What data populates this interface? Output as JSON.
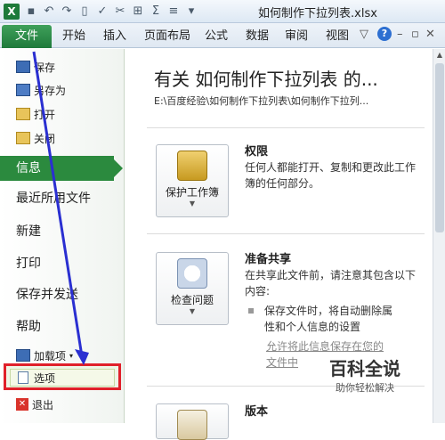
{
  "titlebar": {
    "app_icon": "X",
    "title": "如何制作下拉列表.xlsx"
  },
  "tabs": {
    "file": "文件",
    "items": [
      "开始",
      "插入",
      "页面布局",
      "公式",
      "数据",
      "审阅",
      "视图"
    ],
    "help": "?"
  },
  "nav": {
    "save": "保存",
    "saveas": "另存为",
    "open": "打开",
    "close": "关闭",
    "info": "信息",
    "recent": "最近所用文件",
    "new": "新建",
    "print": "打印",
    "share": "保存并发送",
    "help": "帮助",
    "addins": "加载项",
    "options": "选项",
    "exit": "退出"
  },
  "main": {
    "title": "有关 如何制作下拉列表 的...",
    "path": "E:\\百度经验\\如何制作下拉列表\\如何制作下拉列...",
    "permissions": {
      "button": "保护工作簿",
      "heading": "权限",
      "text": "任何人都能打开、复制和更改此工作簿的任何部分。"
    },
    "prepare": {
      "button": "检查问题",
      "heading": "准备共享",
      "text": "在共享此文件前，请注意其包含以下内容:",
      "bullet": "保存文件时，将自动删除属性和个人信息的设置",
      "link": "允许将此信息保存在您的文件中"
    },
    "versions": {
      "heading": "版本"
    }
  },
  "watermark": {
    "line1": "百科全说",
    "line2": "助你轻松解决"
  },
  "colors": {
    "accent_green": "#2b8a3e",
    "highlight_red": "#e0202a",
    "annotation_blue": "#2a2fd1"
  }
}
